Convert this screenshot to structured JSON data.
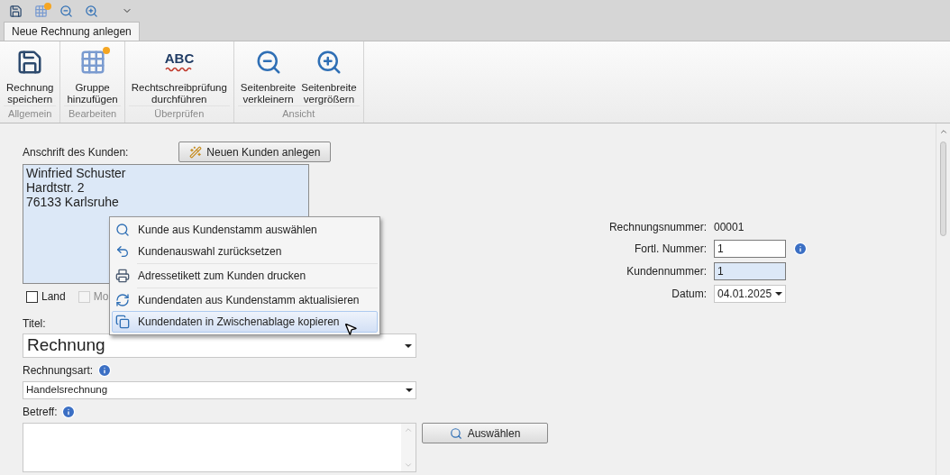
{
  "quick_access": [
    {
      "kind": "save"
    },
    {
      "kind": "group"
    },
    {
      "kind": "zoom-out"
    },
    {
      "kind": "zoom-in"
    },
    {
      "kind": "dropdown"
    }
  ],
  "tabs": [
    {
      "label": "Neue Rechnung anlegen",
      "selected": true
    }
  ],
  "ribbon_groups": [
    {
      "name": "Allgemein",
      "buttons": [
        {
          "label_lines": [
            "Rechnung",
            "speichern"
          ],
          "kind": "save"
        }
      ]
    },
    {
      "name": "Bearbeiten",
      "buttons": [
        {
          "label_lines": [
            "Gruppe",
            "hinzufügen"
          ],
          "kind": "group"
        }
      ]
    },
    {
      "name": "Überprüfen",
      "buttons": [
        {
          "label_lines": [
            "Rechtschreibprüfung",
            "durchführen"
          ],
          "kind": "spellcheck",
          "icon_text": "ABC"
        }
      ]
    },
    {
      "name": "Ansicht",
      "buttons": [
        {
          "label_lines": [
            "Seitenbreite",
            "verkleinern"
          ],
          "kind": "zoom-out"
        },
        {
          "label_lines": [
            "Seitenbreite",
            "vergrößern"
          ],
          "kind": "zoom-in"
        }
      ]
    }
  ],
  "form": {
    "address_label": "Anschrift des Kunden:",
    "new_customer_button": "Neuen Kunden anlegen",
    "address_lines": [
      "Winfried Schuster",
      "Hardtstr. 2",
      "76133 Karlsruhe"
    ],
    "checkboxes": [
      {
        "label": "Land",
        "checked": false,
        "disabled": false
      },
      {
        "label": "Mo",
        "checked": false,
        "disabled": true
      }
    ],
    "title": {
      "label": "Titel:",
      "value": "Rechnung"
    },
    "invoice_type": {
      "label": "Rechnungsart:",
      "value": "Handelsrechnung"
    },
    "subject": {
      "label": "Betreff:"
    },
    "select_button": "Auswählen"
  },
  "right_fields": [
    {
      "label": "Rechnungsnummer:",
      "value": "00001",
      "kind": "text",
      "info": false
    },
    {
      "label": "Fortl. Nummer:",
      "value": "1",
      "kind": "input",
      "info": true
    },
    {
      "label": "Kundennummer:",
      "value": "1",
      "kind": "readonly",
      "info": false
    },
    {
      "label": "Datum:",
      "value": "04.01.2025",
      "kind": "date",
      "info": false
    }
  ],
  "context_menu": [
    {
      "label": "Kunde aus Kundenstamm auswählen",
      "kind": "search",
      "selected": false,
      "separator_after": false
    },
    {
      "label": "Kundenauswahl zurücksetzen",
      "kind": "undo",
      "selected": false,
      "separator_after": true
    },
    {
      "label": "Adressetikett zum Kunden drucken",
      "kind": "print",
      "selected": false,
      "separator_after": true
    },
    {
      "label": "Kundendaten aus Kundenstamm aktualisieren",
      "kind": "refresh",
      "selected": false,
      "separator_after": false
    },
    {
      "label": "Kundendaten in Zwischenablage kopieren",
      "kind": "copy",
      "selected": true,
      "separator_after": false
    }
  ]
}
